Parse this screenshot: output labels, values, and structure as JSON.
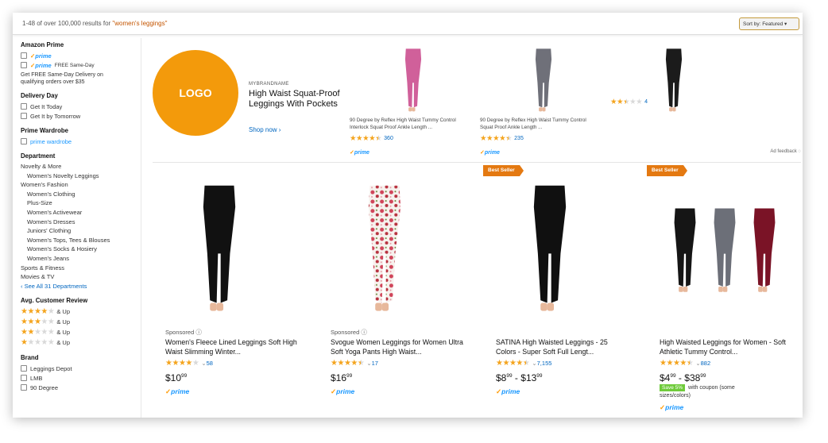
{
  "results": {
    "summary": "1-48 of over 100,000 results for",
    "query": "\"women's leggings\"",
    "sort_label": "Sort by: Featured"
  },
  "sidebar": {
    "amazon_prime": {
      "heading": "Amazon Prime",
      "option1_label": "prime",
      "option2_label": "prime",
      "option2_extra": "FREE Same-Day",
      "note": "Get FREE Same-Day Delivery on qualifying orders over $35"
    },
    "delivery_day": {
      "heading": "Delivery Day",
      "options": [
        "Get It Today",
        "Get It by Tomorrow"
      ]
    },
    "prime_wardrobe": {
      "heading": "Prime Wardrobe",
      "option_label": "prime wardrobe"
    },
    "department": {
      "heading": "Department",
      "links": [
        {
          "label": "Novelty & More",
          "indent": false
        },
        {
          "label": "Women's Novelty Leggings",
          "indent": true
        },
        {
          "label": "Women's Fashion",
          "indent": false
        },
        {
          "label": "Women's Clothing",
          "indent": true
        },
        {
          "label": "Plus-Size",
          "indent": true
        },
        {
          "label": "Women's Activewear",
          "indent": true
        },
        {
          "label": "Women's Dresses",
          "indent": true
        },
        {
          "label": "Juniors' Clothing",
          "indent": true
        },
        {
          "label": "Women's Tops, Tees & Blouses",
          "indent": true
        },
        {
          "label": "Women's Socks & Hosiery",
          "indent": true
        },
        {
          "label": "Women's Jeans",
          "indent": true
        },
        {
          "label": "Sports & Fitness",
          "indent": false
        },
        {
          "label": "Movies & TV",
          "indent": false
        }
      ],
      "see_all": "‹ See All 31 Departments"
    },
    "avg_review": {
      "heading": "Avg. Customer Review",
      "rows": [
        {
          "stars": 4,
          "label": "& Up"
        },
        {
          "stars": 3,
          "label": "& Up"
        },
        {
          "stars": 2,
          "label": "& Up"
        },
        {
          "stars": 1,
          "label": "& Up"
        }
      ]
    },
    "brand": {
      "heading": "Brand",
      "options": [
        "Leggings Depot",
        "LMB",
        "90 Degree"
      ]
    }
  },
  "banner": {
    "logo_text": "LOGO",
    "brand": "MYBRANDNAME",
    "title": "High Waist Squat-Proof Leggings With Pockets",
    "cta": "Shop now ›",
    "ad_feedback": "Ad feedback",
    "products": [
      {
        "title": "90 Degree by Reflex High Waist Tummy Control Interlock Squat Proof Ankle Length ...",
        "rating": 4.5,
        "count": "360",
        "prime": "prime",
        "color": "#d0609a"
      },
      {
        "title": "90 Degree by Reflex High Waist Tummy Control Squat Proof Ankle Length ...",
        "rating": 4.5,
        "count": "235",
        "prime": "prime",
        "color": "#6f7079"
      },
      {
        "title": "",
        "rating": 2.5,
        "count": "4",
        "prime": "",
        "color": "#1b1b1b"
      }
    ]
  },
  "products": [
    {
      "badge": "",
      "sponsored": "Sponsored",
      "title": "Women's Fleece Lined Leggings Soft High Waist Slimming Winter...",
      "rating": 4,
      "count": "58",
      "price_whole": "$10",
      "price_frac": "99",
      "price_sep": "",
      "price2_whole": "",
      "price2_frac": "",
      "prime": "prime",
      "coupon_save": "",
      "coupon_text": "",
      "coupon_note": ""
    },
    {
      "badge": "",
      "sponsored": "Sponsored",
      "title": "Svogue Women Leggings for Women Ultra Soft Yoga Pants High Waist...",
      "rating": 4.5,
      "count": "17",
      "price_whole": "$16",
      "price_frac": "99",
      "price_sep": "",
      "price2_whole": "",
      "price2_frac": "",
      "prime": "prime",
      "coupon_save": "",
      "coupon_text": "",
      "coupon_note": ""
    },
    {
      "badge": "Best Seller",
      "sponsored": "",
      "title": "SATINA High Waisted Leggings - 25 Colors - Super Soft Full Lengt...",
      "rating": 4.5,
      "count": "7,155",
      "price_whole": "$8",
      "price_frac": "99",
      "price_sep": " - ",
      "price2_whole": "$13",
      "price2_frac": "99",
      "prime": "prime",
      "coupon_save": "",
      "coupon_text": "",
      "coupon_note": ""
    },
    {
      "badge": "Best Seller",
      "sponsored": "",
      "title": "High Waisted Leggings for Women - Soft Athletic Tummy Control...",
      "rating": 4.5,
      "count": "882",
      "price_whole": "$4",
      "price_frac": "99",
      "price_sep": " - ",
      "price2_whole": "$38",
      "price2_frac": "99",
      "prime": "prime",
      "coupon_save": "Save 5%",
      "coupon_text": "with coupon (some",
      "coupon_note": "sizes/colors)"
    }
  ],
  "colors": {
    "logo": "#f39a0b",
    "badge": "#e47911",
    "star": "#f4a41d",
    "link": "#0066c0",
    "prime": "#1a98ff"
  }
}
